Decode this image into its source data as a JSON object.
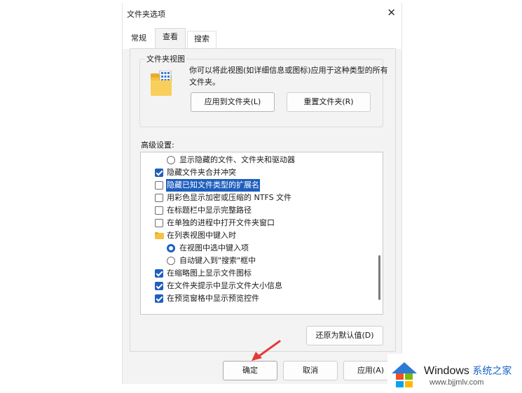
{
  "dialog": {
    "title": "文件夹选项",
    "close_glyph": "✕",
    "tabs": [
      {
        "label": "常规",
        "selected": false
      },
      {
        "label": "查看",
        "selected": true
      },
      {
        "label": "搜索",
        "selected": false
      }
    ]
  },
  "folder_views": {
    "legend": "文件夹视图",
    "description": "你可以将此视图(如详细信息或图标)应用于这种类型的所有文件夹。",
    "apply_button": "应用到文件夹(L)",
    "reset_button": "重置文件夹(R)"
  },
  "advanced": {
    "label": "高级设置:",
    "items": [
      {
        "type": "radio",
        "checked": false,
        "indent": 1,
        "label": "显示隐藏的文件、文件夹和驱动器"
      },
      {
        "type": "checkbox",
        "checked": true,
        "indent": 0,
        "label": "隐藏文件夹合并冲突"
      },
      {
        "type": "checkbox",
        "checked": false,
        "indent": 0,
        "label": "隐藏已知文件类型的扩展名",
        "highlighted": true
      },
      {
        "type": "checkbox",
        "checked": false,
        "indent": 0,
        "label": "用彩色显示加密或压缩的 NTFS 文件"
      },
      {
        "type": "checkbox",
        "checked": false,
        "indent": 0,
        "label": "在标题栏中显示完整路径"
      },
      {
        "type": "checkbox",
        "checked": false,
        "indent": 0,
        "label": "在单独的进程中打开文件夹窗口"
      },
      {
        "type": "folder",
        "indent": 0,
        "label": "在列表视图中键入时"
      },
      {
        "type": "radio",
        "checked": true,
        "indent": 1,
        "label": "在视图中选中键入项"
      },
      {
        "type": "radio",
        "checked": false,
        "indent": 1,
        "label": "自动键入到\"搜索\"框中"
      },
      {
        "type": "checkbox",
        "checked": true,
        "indent": 0,
        "label": "在缩略图上显示文件图标"
      },
      {
        "type": "checkbox",
        "checked": true,
        "indent": 0,
        "label": "在文件夹提示中显示文件大小信息"
      },
      {
        "type": "checkbox",
        "checked": true,
        "indent": 0,
        "label": "在预览窗格中显示预览控件"
      }
    ],
    "restore_button": "还原为默认值(D)"
  },
  "footer": {
    "ok": "确定",
    "cancel": "取消",
    "apply": "应用(A)"
  },
  "watermark": {
    "brand": "Windows",
    "brand_cn": "系统之家",
    "url": "www.bjjmlv.com"
  },
  "colors": {
    "accent": "#1f5fbe",
    "arrow": "#e53935",
    "folder_yellow": "#f5c242"
  }
}
